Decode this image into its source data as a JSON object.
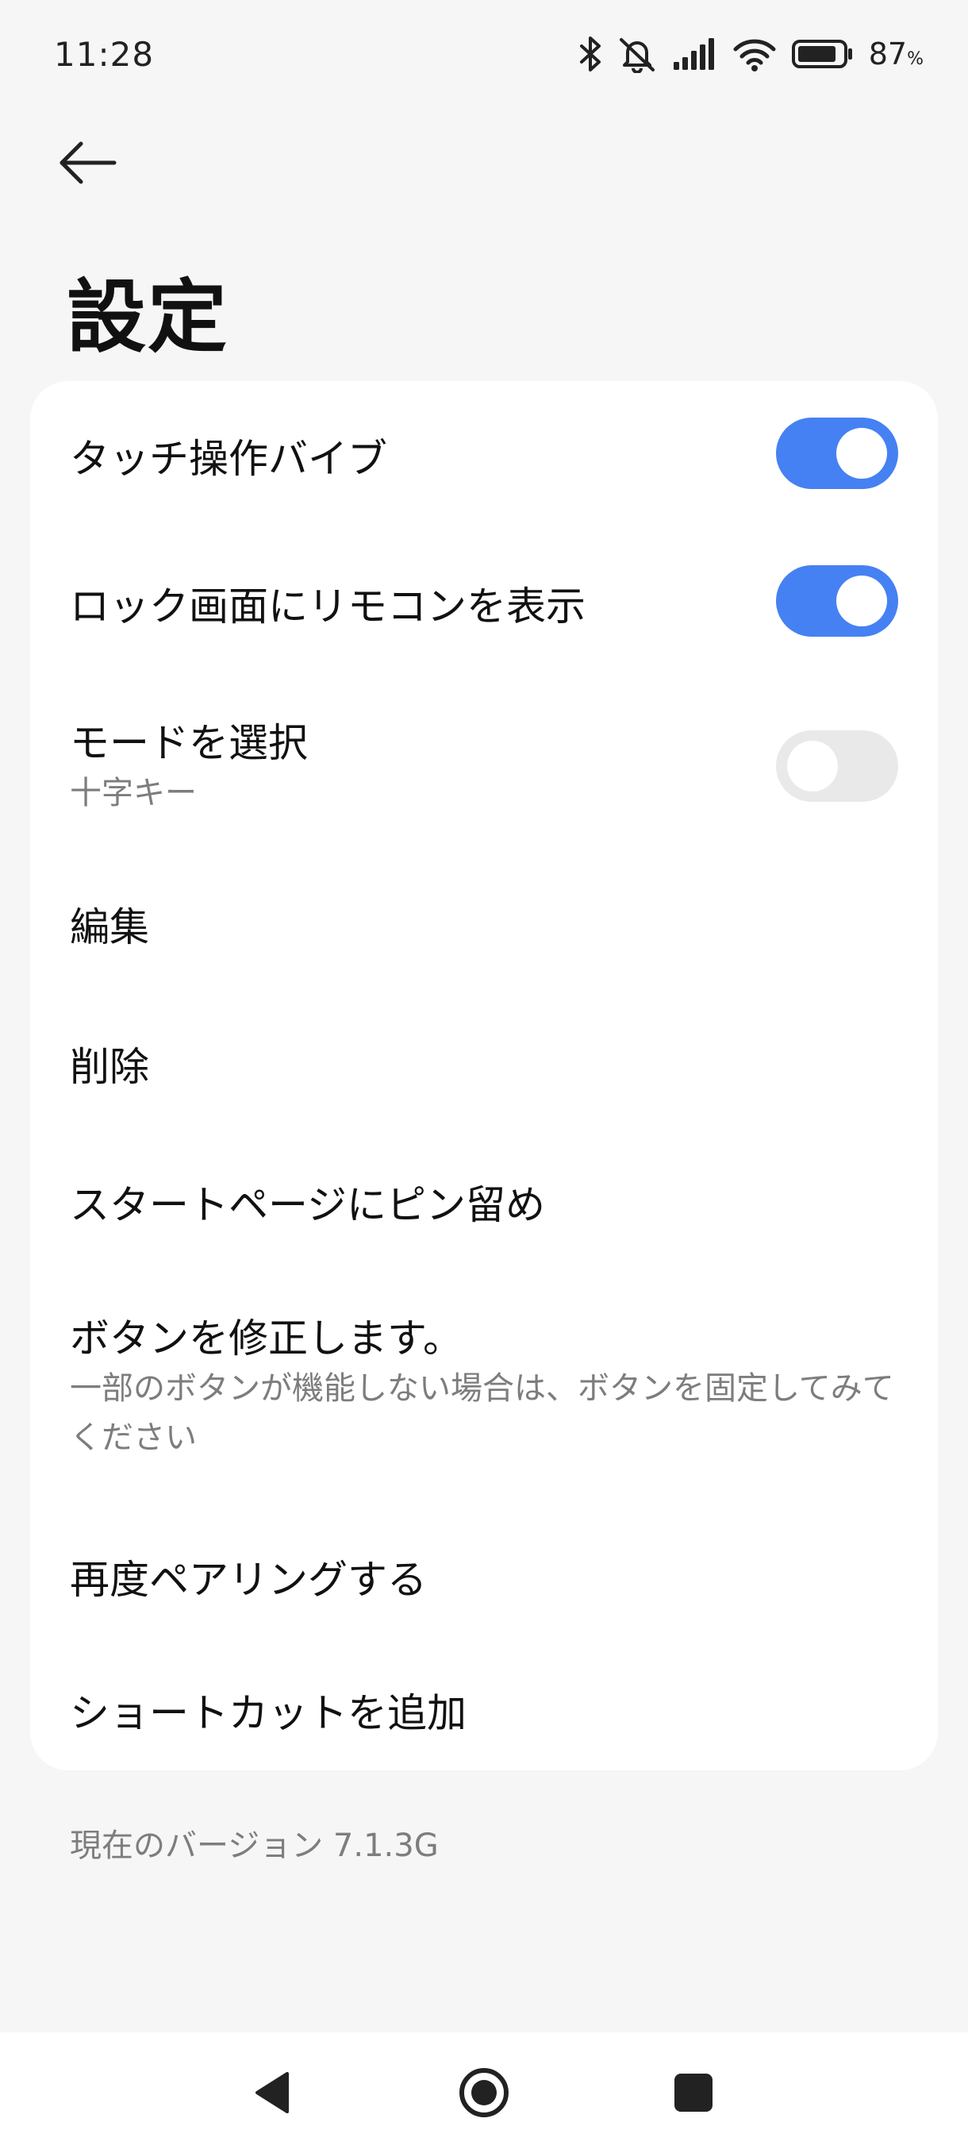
{
  "status_bar": {
    "time": "11:28",
    "battery_percent": "87",
    "battery_unit": "%",
    "icons": [
      "bluetooth-icon",
      "mute-icon",
      "signal-icon",
      "wifi-icon",
      "battery-icon"
    ],
    "battery_level": 0.87
  },
  "header": {
    "back_icon": "arrow-left-icon",
    "title": "設定"
  },
  "settings": {
    "items": [
      {
        "title": "タッチ操作バイブ",
        "toggle": true
      },
      {
        "title": "ロック画面にリモコンを表示",
        "toggle": true
      },
      {
        "title": "モードを選択",
        "subtitle": "十字キー",
        "toggle": false
      },
      {
        "title": "編集"
      },
      {
        "title": "削除"
      },
      {
        "title": "スタートページにピン留め"
      },
      {
        "title": "ボタンを修正します。",
        "subtitle": "一部のボタンが機能しない場合は、ボタンを固定してみてください"
      },
      {
        "title": "再度ペアリングする"
      },
      {
        "title": "ショートカットを追加"
      }
    ]
  },
  "footer": {
    "version": "現在のバージョン 7.1.3G"
  },
  "nav_bar": {
    "buttons": [
      "back-triangle-icon",
      "home-circle-icon",
      "recents-square-icon"
    ]
  },
  "colors": {
    "accent": "#4581f2",
    "toggle_off": "#e9e9e9",
    "background": "#f6f6f6",
    "card": "#ffffff",
    "secondary_text": "#7d7d7d"
  }
}
